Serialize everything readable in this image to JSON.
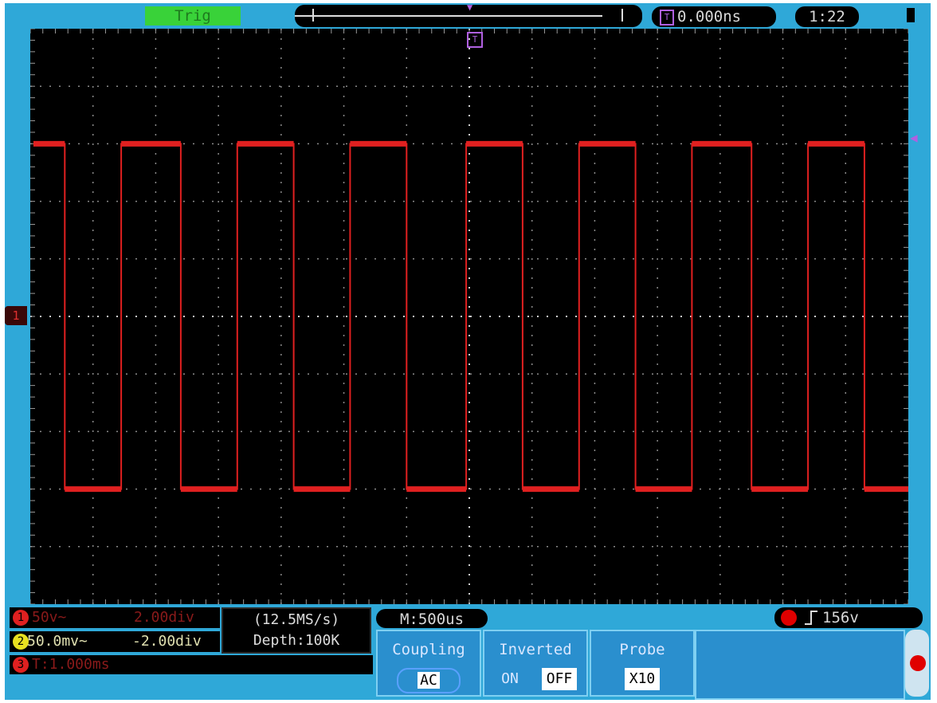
{
  "status_bar": {
    "trigger_status": "Trig",
    "trigger_time": "0.000ns",
    "trigger_time_icon": "T",
    "clock": "1:22",
    "horizontal_position_marker": "T"
  },
  "channels": {
    "ch1": {
      "number": "1",
      "scale": "50v~",
      "offset": "2.00div",
      "color": "#e02020"
    },
    "ch2": {
      "number": "2",
      "scale": "50.0mv~",
      "offset": "-2.00div",
      "color": "#e8e020"
    },
    "ch3": {
      "number": "3",
      "text": "T:1.000ms",
      "color": "#e02020"
    }
  },
  "acquisition": {
    "sample_rate": "(12.5MS/s)",
    "depth": "Depth:100K"
  },
  "timebase": "M:500us",
  "trigger": {
    "level": "156v",
    "edge_icon": "rising-edge-icon"
  },
  "side_markers": {
    "ch1_ground": "1",
    "trigger_level": "◀"
  },
  "menu": [
    {
      "title": "Coupling",
      "options": [
        "AC"
      ],
      "selected": "AC"
    },
    {
      "title": "Inverted",
      "options": [
        "ON",
        "OFF"
      ],
      "selected": "OFF"
    },
    {
      "title": "Probe",
      "options": [
        "X10"
      ],
      "selected": "X10"
    }
  ],
  "chart_data": {
    "type": "line",
    "title": "",
    "xlabel": "",
    "ylabel": "",
    "grid": true,
    "x_divisions": 14,
    "y_divisions": 10,
    "xlim_div": [
      0,
      14
    ],
    "ylim_div": [
      -5,
      5
    ],
    "series": [
      {
        "color": "#e02020",
        "high_div": 3.0,
        "low_div": -3.0,
        "waveform": "square",
        "points_div": [
          [
            0.05,
            3
          ],
          [
            0.55,
            3
          ],
          [
            0.55,
            -3
          ],
          [
            1.45,
            -3
          ],
          [
            1.45,
            3
          ],
          [
            2.4,
            3
          ],
          [
            2.4,
            -3
          ],
          [
            3.3,
            -3
          ],
          [
            3.3,
            3
          ],
          [
            4.2,
            3
          ],
          [
            4.2,
            -3
          ],
          [
            5.1,
            -3
          ],
          [
            5.1,
            3
          ],
          [
            6.0,
            3
          ],
          [
            6.0,
            -3
          ],
          [
            6.95,
            -3
          ],
          [
            6.95,
            3
          ],
          [
            7.85,
            3
          ],
          [
            7.85,
            -3
          ],
          [
            8.75,
            -3
          ],
          [
            8.75,
            3
          ],
          [
            9.65,
            3
          ],
          [
            9.65,
            -3
          ],
          [
            10.55,
            -3
          ],
          [
            10.55,
            3
          ],
          [
            11.5,
            3
          ],
          [
            11.5,
            -3
          ],
          [
            12.4,
            -3
          ],
          [
            12.4,
            3
          ],
          [
            13.3,
            3
          ],
          [
            13.3,
            -3
          ],
          [
            14.0,
            -3
          ]
        ]
      }
    ]
  }
}
